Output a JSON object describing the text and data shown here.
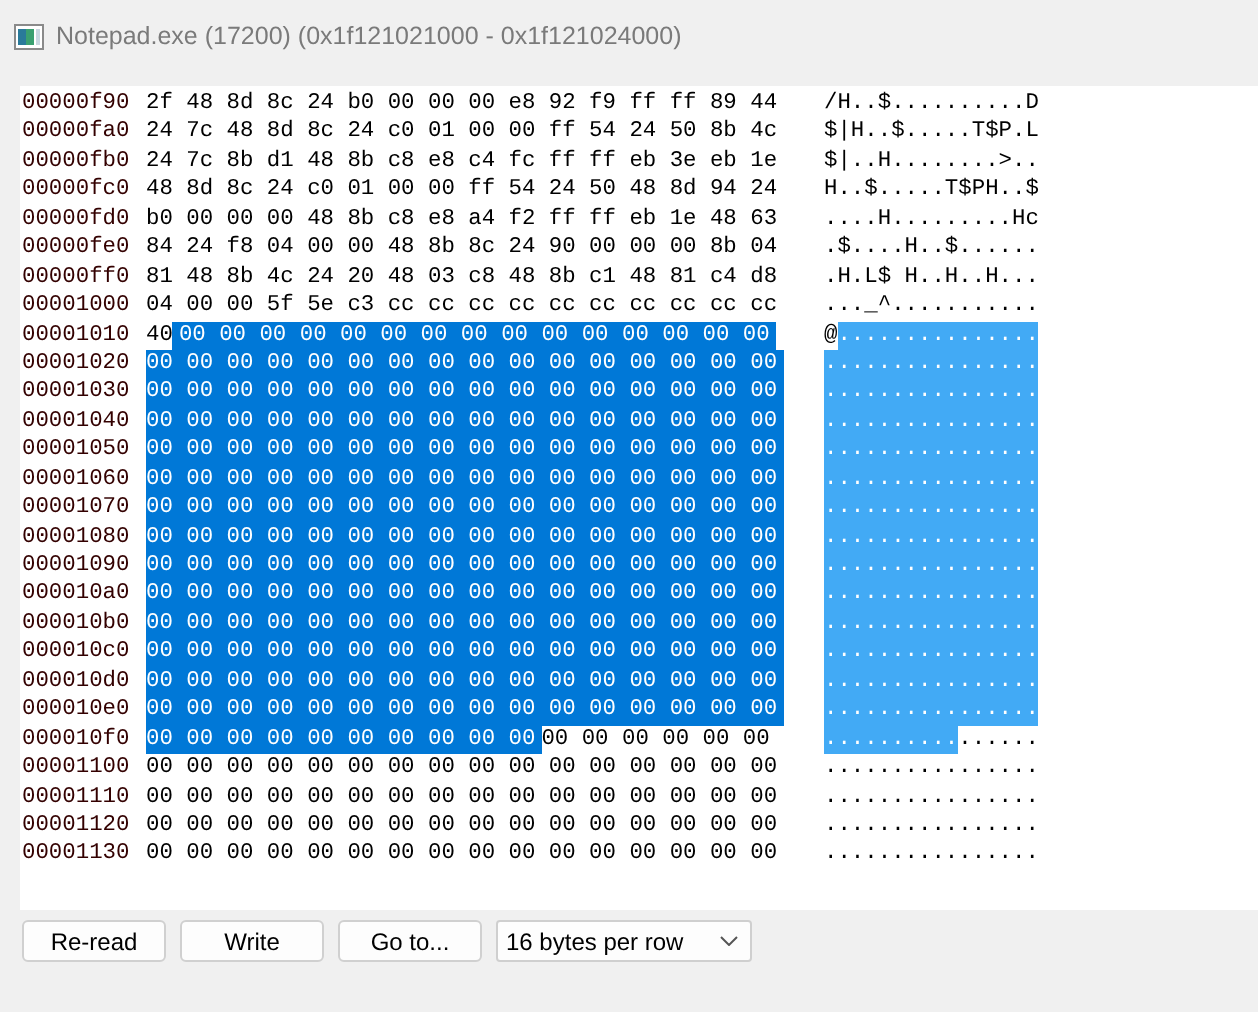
{
  "window": {
    "title": "Notepad.exe (17200) (0x1f121021000 - 0x1f121024000)"
  },
  "rows": [
    {
      "address": "00000f90",
      "segments": [
        {
          "hex": "2f 48 8d 8c 24 b0 00 00 00 e8 92 f9 ff ff 89 44",
          "ascii": "/H..$..........D",
          "selected": false
        }
      ]
    },
    {
      "address": "00000fa0",
      "segments": [
        {
          "hex": "24 7c 48 8d 8c 24 c0 01 00 00 ff 54 24 50 8b 4c",
          "ascii": "$|H..$.....T$P.L",
          "selected": false
        }
      ]
    },
    {
      "address": "00000fb0",
      "segments": [
        {
          "hex": "24 7c 8b d1 48 8b c8 e8 c4 fc ff ff eb 3e eb 1e",
          "ascii": "$|..H........>..",
          "selected": false
        }
      ]
    },
    {
      "address": "00000fc0",
      "segments": [
        {
          "hex": "48 8d 8c 24 c0 01 00 00 ff 54 24 50 48 8d 94 24",
          "ascii": "H..$.....T$PH..$",
          "selected": false
        }
      ]
    },
    {
      "address": "00000fd0",
      "segments": [
        {
          "hex": "b0 00 00 00 48 8b c8 e8 a4 f2 ff ff eb 1e 48 63",
          "ascii": "....H.........Hc",
          "selected": false
        }
      ]
    },
    {
      "address": "00000fe0",
      "segments": [
        {
          "hex": "84 24 f8 04 00 00 48 8b 8c 24 90 00 00 00 8b 04",
          "ascii": ".$....H..$......",
          "selected": false
        }
      ]
    },
    {
      "address": "00000ff0",
      "segments": [
        {
          "hex": "81 48 8b 4c 24 20 48 03 c8 48 8b c1 48 81 c4 d8",
          "ascii": ".H.L$ H..H..H...",
          "selected": false
        }
      ]
    },
    {
      "address": "00001000",
      "segments": [
        {
          "hex": "04 00 00 5f 5e c3 cc cc cc cc cc cc cc cc cc cc",
          "ascii": "..._^...........",
          "selected": false
        }
      ]
    },
    {
      "address": "00001010",
      "segments": [
        {
          "hex": "40",
          "ascii": "@",
          "selected": false
        },
        {
          "hex": "00 00 00 00 00 00 00 00 00 00 00 00 00 00 00",
          "ascii": "...............",
          "selected": true
        }
      ]
    },
    {
      "address": "00001020",
      "segments": [
        {
          "hex": "00 00 00 00 00 00 00 00 00 00 00 00 00 00 00 00",
          "ascii": "................",
          "selected": true
        }
      ]
    },
    {
      "address": "00001030",
      "segments": [
        {
          "hex": "00 00 00 00 00 00 00 00 00 00 00 00 00 00 00 00",
          "ascii": "................",
          "selected": true
        }
      ]
    },
    {
      "address": "00001040",
      "segments": [
        {
          "hex": "00 00 00 00 00 00 00 00 00 00 00 00 00 00 00 00",
          "ascii": "................",
          "selected": true
        }
      ]
    },
    {
      "address": "00001050",
      "segments": [
        {
          "hex": "00 00 00 00 00 00 00 00 00 00 00 00 00 00 00 00",
          "ascii": "................",
          "selected": true
        }
      ]
    },
    {
      "address": "00001060",
      "segments": [
        {
          "hex": "00 00 00 00 00 00 00 00 00 00 00 00 00 00 00 00",
          "ascii": "................",
          "selected": true
        }
      ]
    },
    {
      "address": "00001070",
      "segments": [
        {
          "hex": "00 00 00 00 00 00 00 00 00 00 00 00 00 00 00 00",
          "ascii": "................",
          "selected": true
        }
      ]
    },
    {
      "address": "00001080",
      "segments": [
        {
          "hex": "00 00 00 00 00 00 00 00 00 00 00 00 00 00 00 00",
          "ascii": "................",
          "selected": true
        }
      ]
    },
    {
      "address": "00001090",
      "segments": [
        {
          "hex": "00 00 00 00 00 00 00 00 00 00 00 00 00 00 00 00",
          "ascii": "................",
          "selected": true
        }
      ]
    },
    {
      "address": "000010a0",
      "segments": [
        {
          "hex": "00 00 00 00 00 00 00 00 00 00 00 00 00 00 00 00",
          "ascii": "................",
          "selected": true
        }
      ]
    },
    {
      "address": "000010b0",
      "segments": [
        {
          "hex": "00 00 00 00 00 00 00 00 00 00 00 00 00 00 00 00",
          "ascii": "................",
          "selected": true
        }
      ]
    },
    {
      "address": "000010c0",
      "segments": [
        {
          "hex": "00 00 00 00 00 00 00 00 00 00 00 00 00 00 00 00",
          "ascii": "................",
          "selected": true
        }
      ]
    },
    {
      "address": "000010d0",
      "segments": [
        {
          "hex": "00 00 00 00 00 00 00 00 00 00 00 00 00 00 00 00",
          "ascii": "................",
          "selected": true
        }
      ]
    },
    {
      "address": "000010e0",
      "segments": [
        {
          "hex": "00 00 00 00 00 00 00 00 00 00 00 00 00 00 00 00",
          "ascii": "................",
          "selected": true
        }
      ]
    },
    {
      "address": "000010f0",
      "segments": [
        {
          "hex": "00 00 00 00 00 00 00 00 00 00",
          "ascii": "..........",
          "selected": true
        },
        {
          "hex": "00 00 00 00 00 00",
          "ascii": "......",
          "selected": false
        }
      ]
    },
    {
      "address": "00001100",
      "segments": [
        {
          "hex": "00 00 00 00 00 00 00 00 00 00 00 00 00 00 00 00",
          "ascii": "................",
          "selected": false
        }
      ]
    },
    {
      "address": "00001110",
      "segments": [
        {
          "hex": "00 00 00 00 00 00 00 00 00 00 00 00 00 00 00 00",
          "ascii": "................",
          "selected": false
        }
      ]
    },
    {
      "address": "00001120",
      "segments": [
        {
          "hex": "00 00 00 00 00 00 00 00 00 00 00 00 00 00 00 00",
          "ascii": "................",
          "selected": false
        }
      ]
    },
    {
      "address": "00001130",
      "segments": [
        {
          "hex": "00 00 00 00 00 00 00 00 00 00 00 00 00 00 00 00",
          "ascii": "................",
          "selected": false
        }
      ]
    }
  ],
  "buttons": [
    "Re-read",
    "Write",
    "Go to..."
  ],
  "row_size_select": {
    "value": "16 bytes per row"
  }
}
